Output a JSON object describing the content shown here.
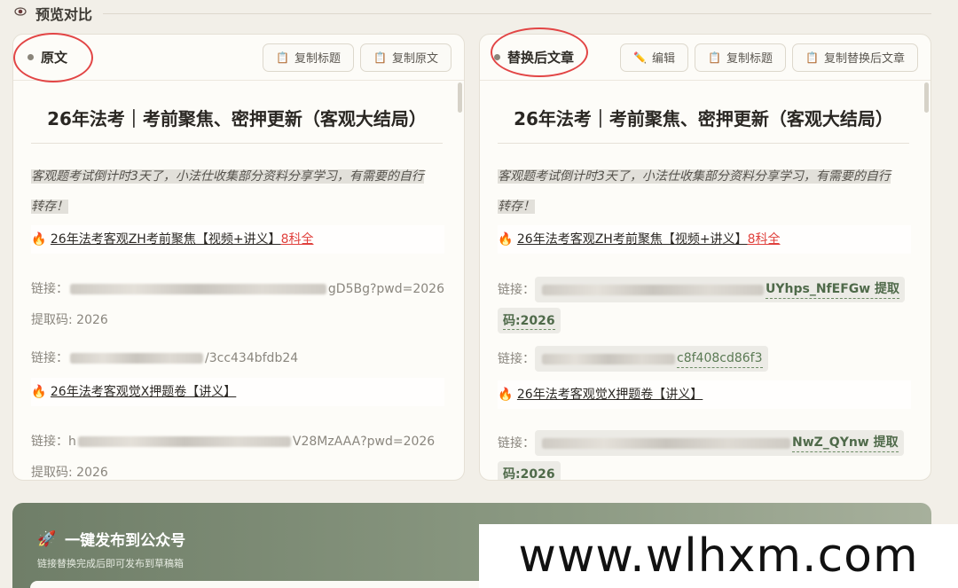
{
  "section": {
    "icon": "eye-icon",
    "title": "预览对比"
  },
  "left_panel": {
    "title": "原文",
    "buttons": [
      {
        "label": "复制标题",
        "icon": "clipboard-icon"
      },
      {
        "label": "复制原文",
        "icon": "clipboard-icon"
      }
    ],
    "doc_title": "26年法考｜考前聚焦、密押更新（客观大结局）",
    "quote_1": "客观题考试倒计时3天了，小法仕收集部分资料分享学习，有需要的自行",
    "quote_2": "转存！",
    "item_1": {
      "prefix": "🔥",
      "text": "26年法考客观ZH考前聚焦【视频+讲义】",
      "highlight": "8科全"
    },
    "link_1_label": "链接：",
    "link_1_tail": "gD5Bg?pwd=2026",
    "code_1": "提取码: 2026",
    "link_2_label": "链接：",
    "link_2_tail": "/3cc434bfdb24",
    "item_2": {
      "prefix": "🔥",
      "text": "26年法考客观觉X押题卷【讲义】"
    },
    "link_3_label": "链接：",
    "link_3_head": "h",
    "link_3_tail": "V28MzAAA?pwd=2026",
    "code_2": "提取码: 2026"
  },
  "right_panel": {
    "title": "替换后文章",
    "buttons": [
      {
        "label": "编辑",
        "icon": "pencil-icon"
      },
      {
        "label": "复制标题",
        "icon": "clipboard-icon"
      },
      {
        "label": "复制替换后文章",
        "icon": "clipboard-icon"
      }
    ],
    "doc_title": "26年法考｜考前聚焦、密押更新（客观大结局）",
    "quote_1": "客观题考试倒计时3天了，小法仕收集部分资料分享学习，有需要的自行",
    "quote_2": "转存！",
    "item_1": {
      "prefix": "🔥",
      "text": "26年法考客观ZH考前聚焦【视频+讲义】",
      "highlight": "8科全"
    },
    "link_1_label": "链接：",
    "link_1_tail": "UYhps_NfEFGw 提取",
    "code_1": "码:2026",
    "link_2_label": "链接：",
    "link_2_tail": "c8f408cd86f3",
    "item_2": {
      "prefix": "🔥",
      "text": "26年法考客观觉X押题卷【讲义】"
    },
    "link_3_label": "链接：",
    "link_3_tail": "NwZ_QYnw 提取",
    "code_2": "码:2026"
  },
  "publish": {
    "icon": "rocket-icon",
    "title": "一键发布到公众号",
    "subtitle": "链接替换完成后即可发布到草稿箱"
  },
  "watermark": "www.wlhxm.com",
  "colors": {
    "accent_red": "#e0403c",
    "tag_green": "#4f6a4a",
    "panel_bg": "#fdfcf8",
    "page_bg": "#f2efe8"
  }
}
